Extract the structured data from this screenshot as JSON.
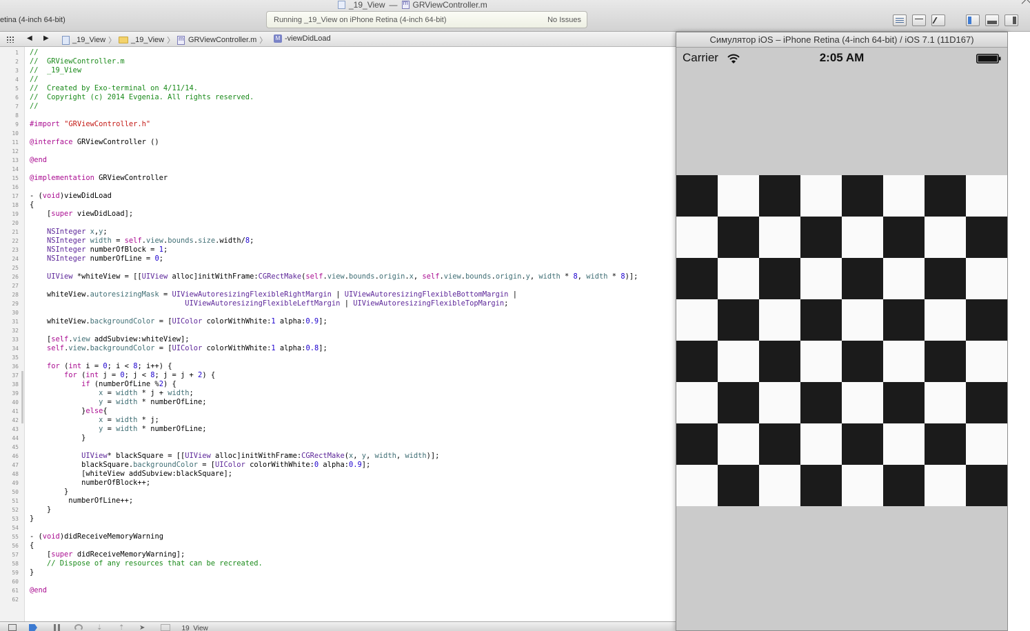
{
  "toolbar": {
    "scheme": "etina (4-inch 64-bit)",
    "window_title": {
      "project": "_19_View",
      "separator": "—",
      "file": "GRViewController.m"
    },
    "activity": {
      "status": "Running _19_View on iPhone Retina (4-inch 64-bit)",
      "issues": "No Issues"
    }
  },
  "jumpbar": {
    "project": "_19_View",
    "group": "_19_View",
    "file": "GRViewController.m",
    "method": "-viewDidLoad"
  },
  "editor": {
    "lines": [
      {
        "n": "1",
        "text": "//",
        "type": "comment"
      },
      {
        "n": "2",
        "text": "//  GRViewController.m",
        "type": "comment"
      },
      {
        "n": "3",
        "text": "//  _19_View",
        "type": "comment"
      },
      {
        "n": "4",
        "text": "//",
        "type": "comment"
      },
      {
        "n": "5",
        "text": "//  Created by Exo-terminal on 4/11/14.",
        "type": "comment"
      },
      {
        "n": "6",
        "text": "//  Copyright (c) 2014 Evgenia. All rights reserved.",
        "type": "comment"
      },
      {
        "n": "7",
        "text": "//",
        "type": "comment"
      },
      {
        "n": "8",
        "text": "",
        "type": "code"
      },
      {
        "n": "9",
        "text": "#import \"GRViewController.h\"",
        "type": "code"
      },
      {
        "n": "10",
        "text": "",
        "type": "code"
      },
      {
        "n": "11",
        "text": "@interface GRViewController ()",
        "type": "code"
      },
      {
        "n": "12",
        "text": "",
        "type": "code"
      },
      {
        "n": "13",
        "text": "@end",
        "type": "code"
      },
      {
        "n": "14",
        "text": "",
        "type": "code"
      },
      {
        "n": "15",
        "text": "@implementation GRViewController",
        "type": "code"
      },
      {
        "n": "16",
        "text": "",
        "type": "code"
      },
      {
        "n": "17",
        "text": "- (void)viewDidLoad",
        "type": "code"
      },
      {
        "n": "18",
        "text": "{",
        "type": "code"
      },
      {
        "n": "19",
        "text": "    [super viewDidLoad];",
        "type": "code"
      },
      {
        "n": "20",
        "text": "",
        "type": "code"
      },
      {
        "n": "21",
        "text": "    NSInteger x,y;",
        "type": "code"
      },
      {
        "n": "22",
        "text": "    NSInteger width = self.view.bounds.size.width/8;",
        "type": "code"
      },
      {
        "n": "23",
        "text": "    NSInteger numberOfBlock = 1;",
        "type": "code"
      },
      {
        "n": "24",
        "text": "    NSInteger numberOfLine = 0;",
        "type": "code"
      },
      {
        "n": "25",
        "text": "",
        "type": "code"
      },
      {
        "n": "26",
        "text": "    UIView *whiteView = [[UIView alloc]initWithFrame:CGRectMake(self.view.bounds.origin.x, self.view.bounds.origin.y, width * 8, width * 8)];",
        "type": "code"
      },
      {
        "n": "27",
        "text": "",
        "type": "code"
      },
      {
        "n": "28",
        "text": "    whiteView.autoresizingMask = UIViewAutoresizingFlexibleRightMargin | UIViewAutoresizingFlexibleBottomMargin |",
        "type": "code"
      },
      {
        "n": "29",
        "text": "                                    UIViewAutoresizingFlexibleLeftMargin | UIViewAutoresizingFlexibleTopMargin;",
        "type": "code"
      },
      {
        "n": "30",
        "text": "",
        "type": "code"
      },
      {
        "n": "31",
        "text": "    whiteView.backgroundColor = [UIColor colorWithWhite:1 alpha:0.9];",
        "type": "code"
      },
      {
        "n": "32",
        "text": "",
        "type": "code"
      },
      {
        "n": "33",
        "text": "    [self.view addSubview:whiteView];",
        "type": "code"
      },
      {
        "n": "34",
        "text": "    self.view.backgroundColor = [UIColor colorWithWhite:1 alpha:0.8];",
        "type": "code"
      },
      {
        "n": "35",
        "text": "",
        "type": "code"
      },
      {
        "n": "36",
        "text": "    for (int i = 0; i < 8; i++) {",
        "type": "code"
      },
      {
        "n": "37",
        "text": "        for (int j = 0; j < 8; j = j + 2) {",
        "type": "code"
      },
      {
        "n": "38",
        "text": "            if (numberOfLine %2) {",
        "type": "code"
      },
      {
        "n": "39",
        "text": "                x = width * j + width;",
        "type": "code"
      },
      {
        "n": "40",
        "text": "                y = width * numberOfLine;",
        "type": "code"
      },
      {
        "n": "41",
        "text": "            }else{",
        "type": "code"
      },
      {
        "n": "42",
        "text": "                x = width * j;",
        "type": "code"
      },
      {
        "n": "43",
        "text": "                y = width * numberOfLine;",
        "type": "code"
      },
      {
        "n": "44",
        "text": "            }",
        "type": "code"
      },
      {
        "n": "45",
        "text": "",
        "type": "code"
      },
      {
        "n": "46",
        "text": "            UIView* blackSquare = [[UIView alloc]initWithFrame:CGRectMake(x, y, width, width)];",
        "type": "code"
      },
      {
        "n": "47",
        "text": "            blackSquare.backgroundColor = [UIColor colorWithWhite:0 alpha:0.9];",
        "type": "code"
      },
      {
        "n": "48",
        "text": "            [whiteView addSubview:blackSquare];",
        "type": "code"
      },
      {
        "n": "49",
        "text": "            numberOfBlock++;",
        "type": "code"
      },
      {
        "n": "50",
        "text": "        }",
        "type": "code"
      },
      {
        "n": "51",
        "text": "         numberOfLine++;",
        "type": "code"
      },
      {
        "n": "52",
        "text": "    }",
        "type": "code"
      },
      {
        "n": "53",
        "text": "}",
        "type": "code"
      },
      {
        "n": "54",
        "text": "",
        "type": "code"
      },
      {
        "n": "55",
        "text": "- (void)didReceiveMemoryWarning",
        "type": "code"
      },
      {
        "n": "56",
        "text": "{",
        "type": "code"
      },
      {
        "n": "57",
        "text": "    [super didReceiveMemoryWarning];",
        "type": "code"
      },
      {
        "n": "58",
        "text": "    // Dispose of any resources that can be recreated.",
        "type": "comment"
      },
      {
        "n": "59",
        "text": "}",
        "type": "code"
      },
      {
        "n": "60",
        "text": "",
        "type": "code"
      },
      {
        "n": "61",
        "text": "@end",
        "type": "code"
      },
      {
        "n": "62",
        "text": "",
        "type": "code"
      }
    ]
  },
  "debugbar": {
    "target": "_19_View"
  },
  "simulator": {
    "title": "Симулятор iOS – iPhone Retina (4-inch 64-bit) / iOS 7.1 (11D167)",
    "status_bar": {
      "carrier": "Carrier",
      "time": "2:05 AM"
    },
    "board": {
      "rows": 8,
      "cols": 8,
      "black": "#1b1b1b",
      "white": "#fafafa",
      "first_black": "top-left"
    },
    "background": "#cbcbcb"
  },
  "colors": {
    "keyword": "#aa0d91",
    "string": "#c41a16",
    "number": "#1c00cf",
    "class": "#5c2699",
    "method": "#26474b",
    "property": "#3f6e74",
    "comment": "#1a8a1a"
  }
}
